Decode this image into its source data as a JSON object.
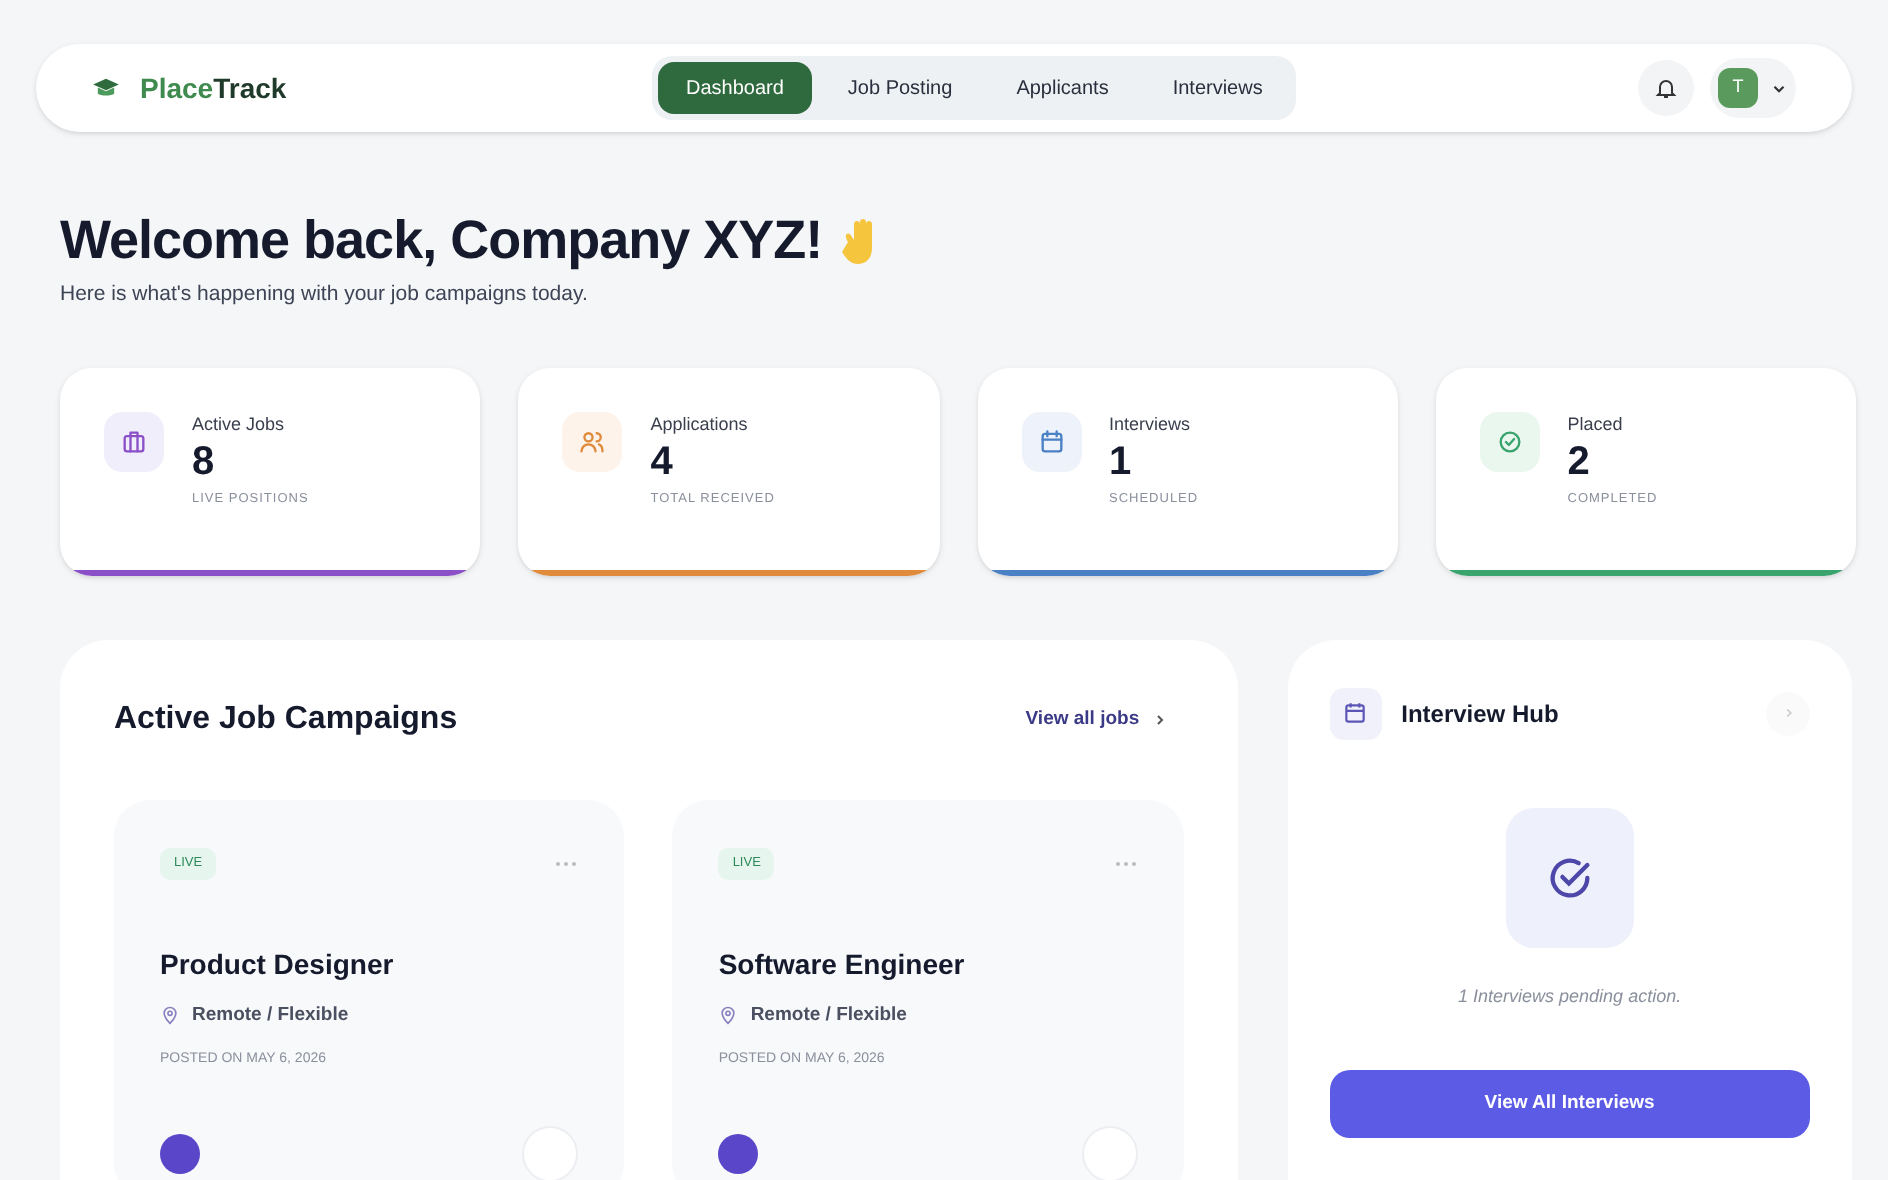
{
  "brand": {
    "first": "Place",
    "second": "Track"
  },
  "nav": [
    {
      "label": "Dashboard",
      "selected": true
    },
    {
      "label": "Job Posting",
      "selected": false
    },
    {
      "label": "Applicants",
      "selected": false
    },
    {
      "label": "Interviews",
      "selected": false
    }
  ],
  "user": {
    "initial": "T"
  },
  "welcome": {
    "title": "Welcome back, Company XYZ!",
    "subtitle": "Here is what's happening with your job campaigns today."
  },
  "stats": [
    {
      "kind": "jobs",
      "label": "Active Jobs",
      "value": "8",
      "caption": "LIVE POSITIONS",
      "color": "#8b4fc7"
    },
    {
      "kind": "applications",
      "label": "Applications",
      "value": "4",
      "caption": "TOTAL RECEIVED",
      "color": "#e08a3c"
    },
    {
      "kind": "interviews",
      "label": "Interviews",
      "value": "1",
      "caption": "SCHEDULED",
      "color": "#4a80c4"
    },
    {
      "kind": "placed",
      "label": "Placed",
      "value": "2",
      "caption": "COMPLETED",
      "color": "#3aa46e"
    }
  ],
  "campaigns": {
    "title": "Active Job Campaigns",
    "link": "View all jobs",
    "jobs": [
      {
        "status": "LIVE",
        "title": "Product Designer",
        "location": "Remote / Flexible",
        "posted": "POSTED ON MAY 6, 2026"
      },
      {
        "status": "LIVE",
        "title": "Software Engineer",
        "location": "Remote / Flexible",
        "posted": "POSTED ON MAY 6, 2026"
      }
    ]
  },
  "hub": {
    "title": "Interview Hub",
    "message": "1 Interviews pending action.",
    "button": "View All Interviews"
  }
}
